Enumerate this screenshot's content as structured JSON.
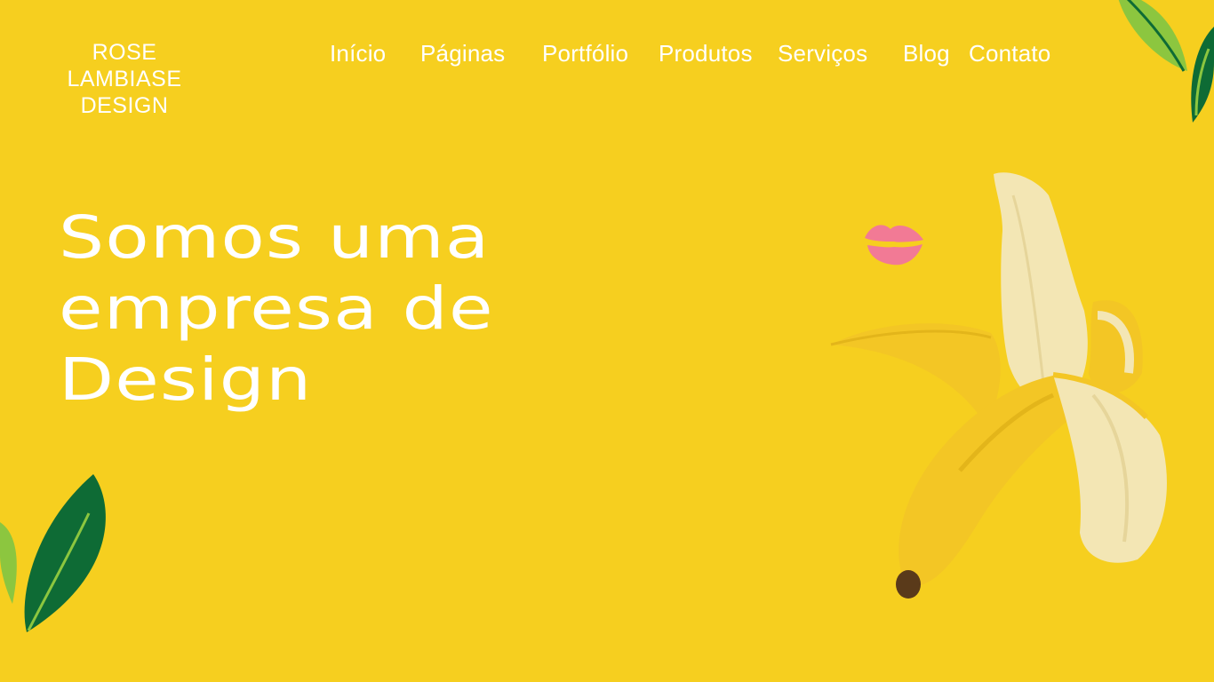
{
  "brand": {
    "logo_lines": [
      "ROSE",
      "LAMBIASE",
      "DESIGN"
    ]
  },
  "nav": {
    "items": [
      {
        "label": "Início"
      },
      {
        "label": "Páginas"
      },
      {
        "label": "Portfólio"
      },
      {
        "label": "Produtos"
      },
      {
        "label": "Serviços"
      },
      {
        "label": "Blog"
      },
      {
        "label": "Contato"
      }
    ]
  },
  "hero": {
    "title_lines": [
      "Somos uma",
      "empresa de",
      "Design"
    ]
  },
  "colors": {
    "background": "#F6CF1F",
    "text": "#FFFFFF",
    "leaf_dark": "#0E6B35",
    "leaf_light": "#8CC63F",
    "kiss": "#F27A95",
    "banana_peel": "#F3C625",
    "banana_flesh": "#F3E6B4"
  },
  "icons": {
    "leaf_top": "leaf-decoration-icon",
    "leaf_bottom": "leaf-decoration-icon",
    "kiss": "lipstick-kiss-icon",
    "banana": "peeled-banana-image"
  }
}
